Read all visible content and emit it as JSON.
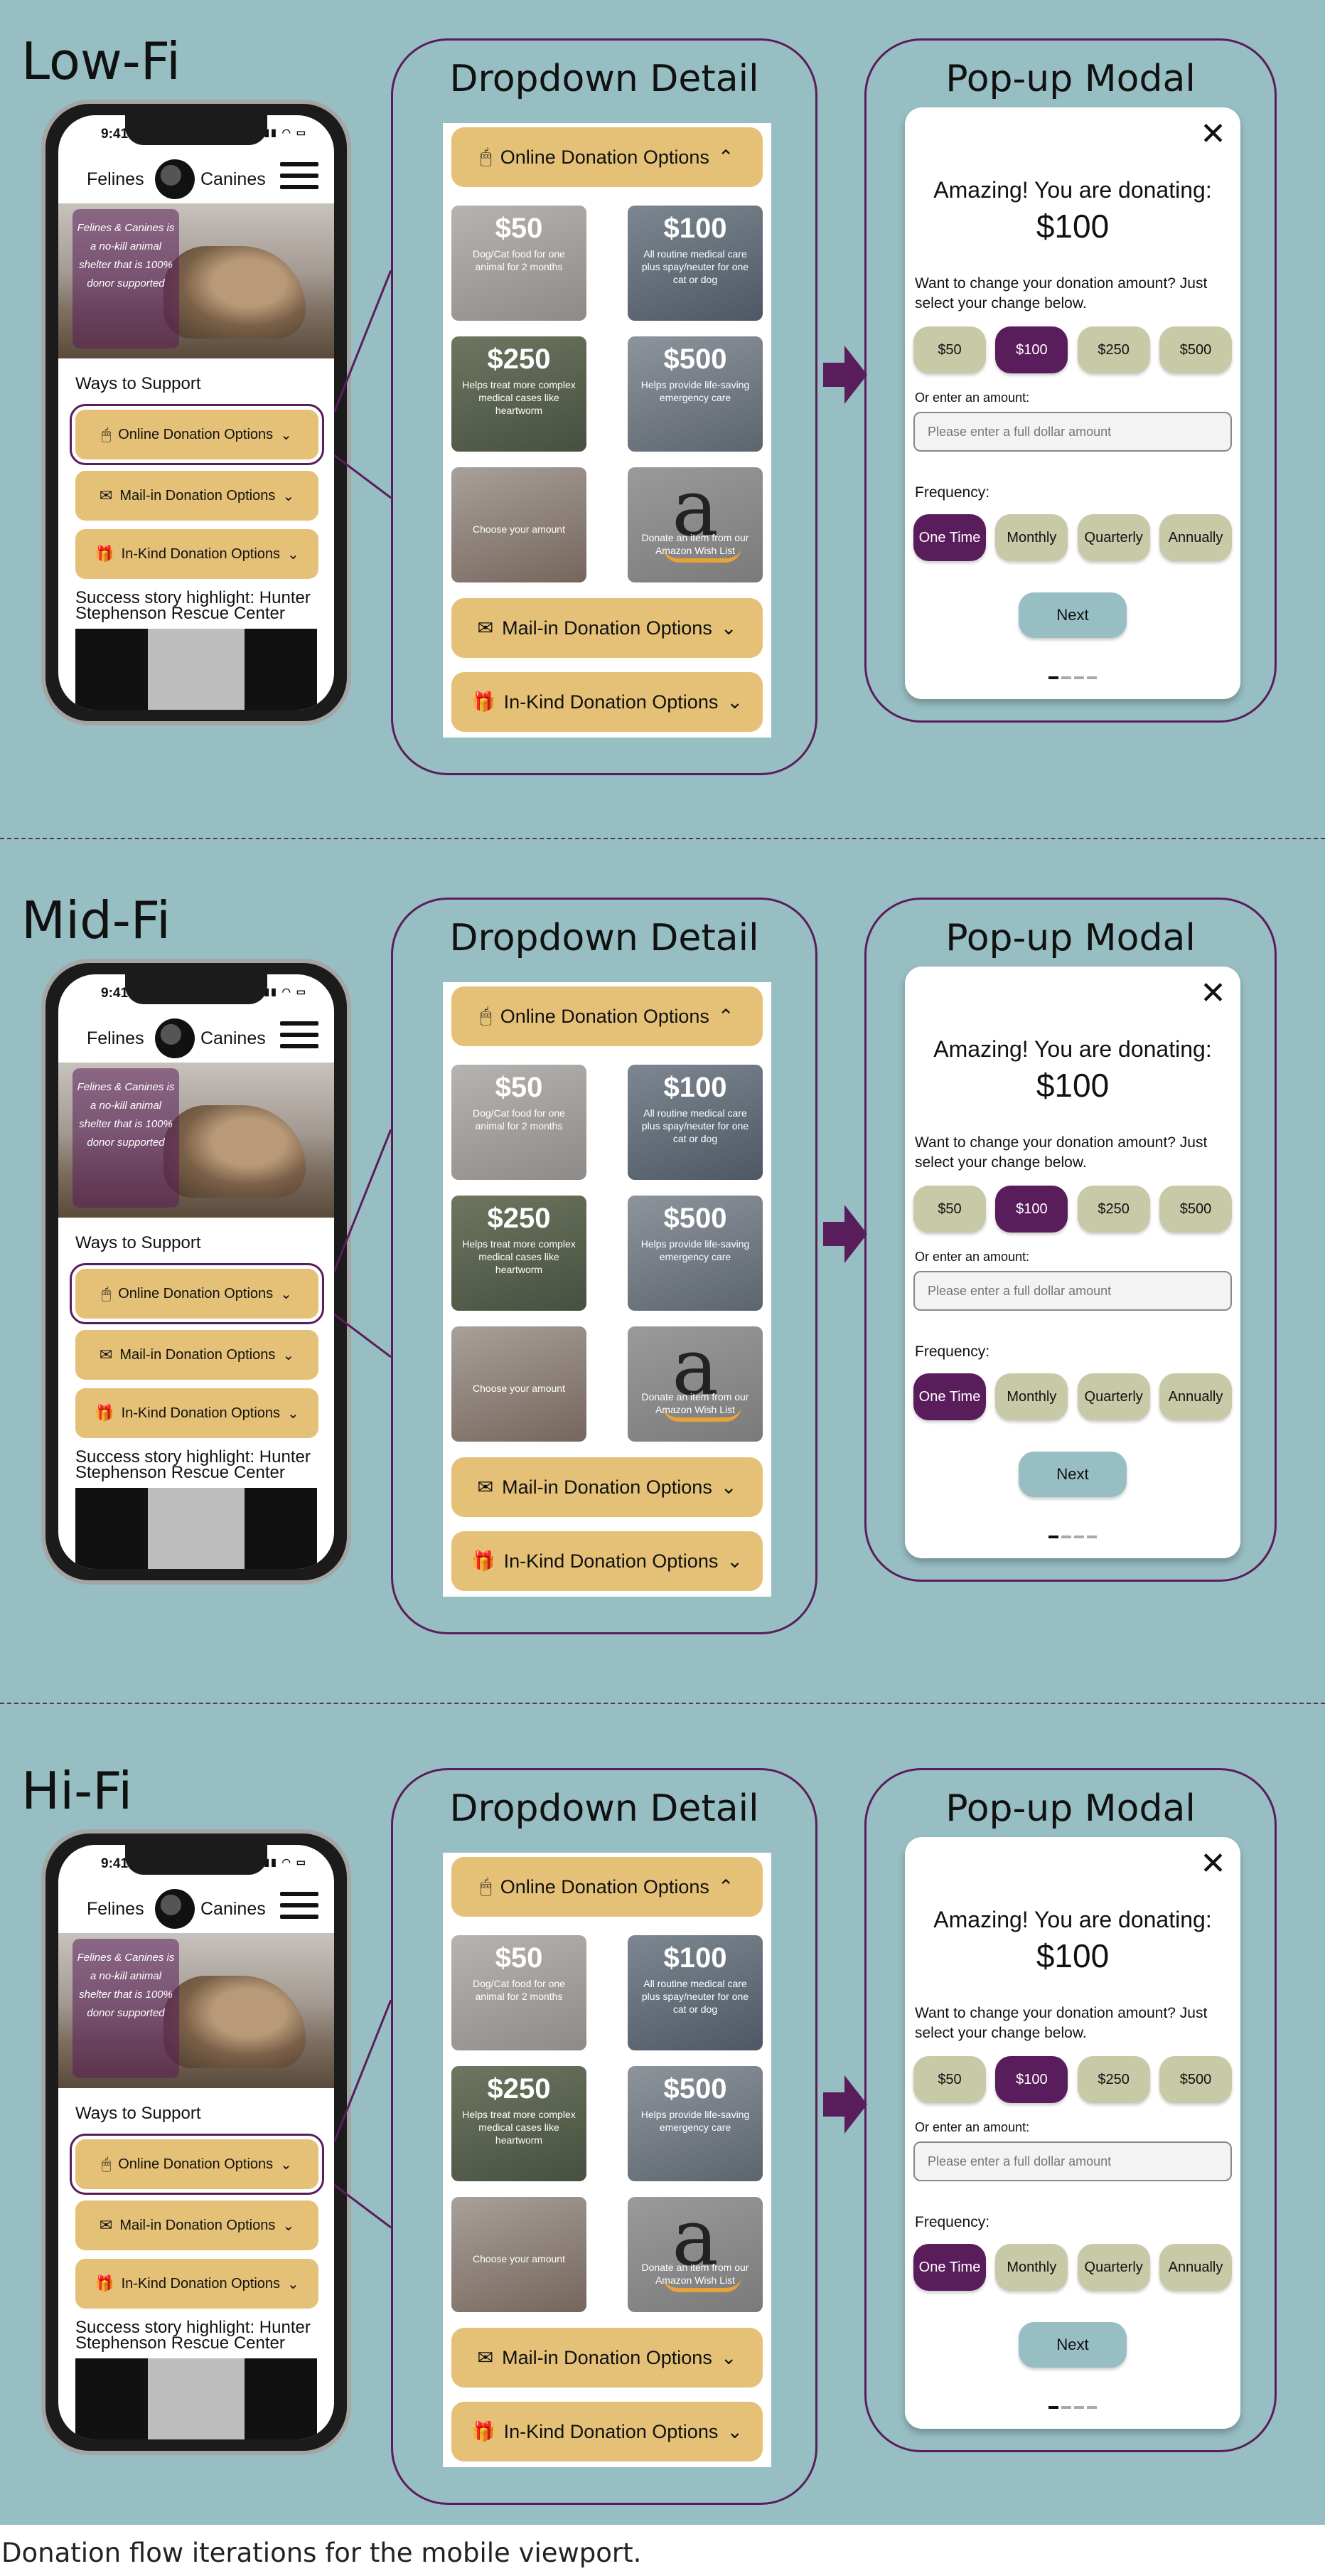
{
  "caption": "Donation flow iterations for the mobile viewport.",
  "colors": {
    "background": "#97bfc3",
    "accent_purple": "#5a1d5c",
    "button_gold": "#e5c177",
    "chip_sage": "#c8c9a7"
  },
  "phone": {
    "time": "9:41",
    "status_icons": "▮▮▮ ◠ ▭",
    "brand_left": "Felines",
    "brand_right": "Canines",
    "hero_tagline": "Felines & Canines is a no-kill animal shelter that is 100% donor supported",
    "ways_heading": "Ways to Support",
    "buttons": [
      {
        "label": "Online Donation Options",
        "icon": "mouse-icon"
      },
      {
        "label": "Mail-in Donation Options",
        "icon": "envelope-icon"
      },
      {
        "label": "In-Kind Donation Options",
        "icon": "hand-gift-icon"
      }
    ],
    "story": "Success story highlight: Hunter Stephenson Rescue Center"
  },
  "dropdown": {
    "title": "Dropdown Detail",
    "top_button": "Online Donation Options",
    "tiles": [
      {
        "amount": "$50",
        "text": "Dog/Cat food for one animal for 2 months"
      },
      {
        "amount": "$100",
        "text": "All routine medical care plus spay/neuter for one cat or dog"
      },
      {
        "amount": "$250",
        "text": "Helps treat more complex medical cases like heartworm"
      },
      {
        "amount": "$500",
        "text": "Helps provide life-saving emergency care"
      },
      {
        "amount": "",
        "text": "Choose your amount"
      },
      {
        "amount": "",
        "text": "Donate an item from our Amazon Wish List",
        "logo": "a"
      }
    ],
    "mail_button": "Mail-in Donation Options",
    "inkind_button": "In-Kind Donation Options"
  },
  "modal": {
    "title": "Pop-up Modal",
    "close": "✕",
    "heading": "Amazing! You are donating:",
    "amount": "$100",
    "change_prompt": "Want to change your donation amount? Just select your change below.",
    "amounts": [
      "$50",
      "$100",
      "$250",
      "$500"
    ],
    "selected_amount": "$100",
    "or_label": "Or enter an amount:",
    "input_placeholder": "Please enter a full dollar amount",
    "frequency_label": "Frequency:",
    "frequencies": [
      "One Time",
      "Monthly",
      "Quarterly",
      "Annually"
    ],
    "selected_frequency": "One Time",
    "next": "Next"
  },
  "stages": [
    "Low-Fi",
    "Mid-Fi",
    "Hi-Fi"
  ]
}
